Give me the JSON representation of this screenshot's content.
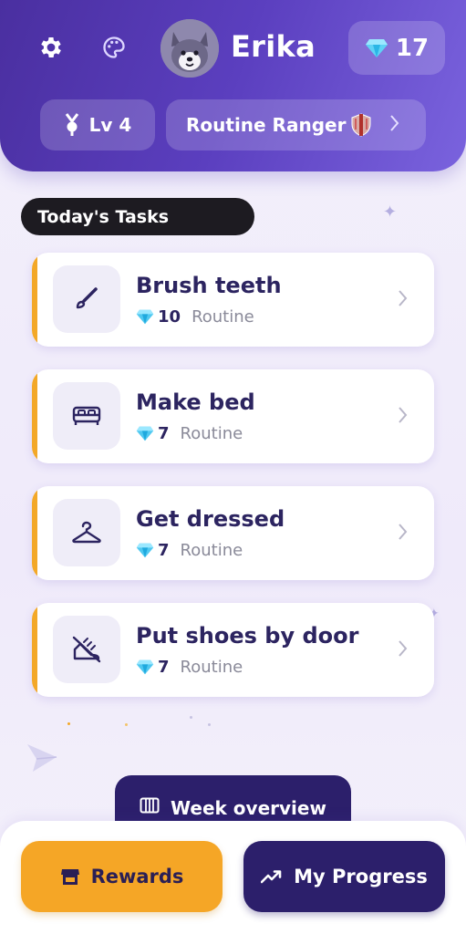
{
  "header": {
    "settings_icon": "gear-icon",
    "theme_icon": "palette-icon",
    "username": "Erika",
    "gems": "17",
    "level": "Lv 4",
    "title": "Routine Ranger",
    "title_badge_icon": "shield-icon"
  },
  "section": {
    "label": "Today's Tasks"
  },
  "tasks": [
    {
      "title": "Brush teeth",
      "points": "10",
      "category": "Routine",
      "icon": "brush-icon"
    },
    {
      "title": "Make bed",
      "points": "7",
      "category": "Routine",
      "icon": "bed-icon"
    },
    {
      "title": "Get dressed",
      "points": "7",
      "category": "Routine",
      "icon": "hanger-icon"
    },
    {
      "title": "Put shoes by door",
      "points": "7",
      "category": "Routine",
      "icon": "shoe-icon"
    }
  ],
  "week_button": {
    "label": "Week overview"
  },
  "bottom_nav": {
    "rewards_label": "Rewards",
    "progress_label": "My Progress"
  },
  "colors": {
    "header_gradient_start": "#4a2fa0",
    "header_gradient_end": "#7a63de",
    "accent": "#f3a828",
    "primary_dark": "#2c1f6b",
    "task_title": "#2c2460"
  }
}
